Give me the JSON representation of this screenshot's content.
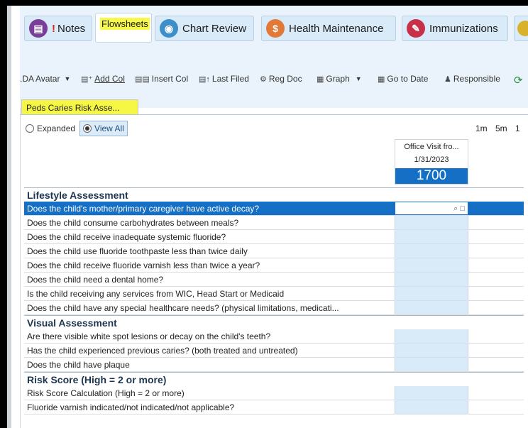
{
  "tabs": [
    {
      "label": "Notes",
      "icon": "notes-icon",
      "badge": "!"
    },
    {
      "label": "Flowsheets",
      "icon": "",
      "active": true
    },
    {
      "label": "Chart Review",
      "icon": "chart-review-icon"
    },
    {
      "label": "Health Maintenance",
      "icon": "health-maintenance-icon"
    },
    {
      "label": "Immunizations",
      "icon": "immunizations-icon"
    }
  ],
  "toolbar": {
    "avatar": ".DA Avatar",
    "add_col": "Add Col",
    "insert_col": "Insert Col",
    "last_filed": "Last Filed",
    "reg_doc": "Reg Doc",
    "graph": "Graph",
    "go_to_date": "Go to Date",
    "responsible": "Responsible"
  },
  "sheet_tab": "Peds Caries Risk Asse...",
  "view": {
    "expanded": "Expanded",
    "view_all": "View All",
    "times": "1m 5m 1"
  },
  "column": {
    "title": "Office Visit fro...",
    "date": "1/31/2023",
    "time": "1700"
  },
  "sections": [
    {
      "title": "Lifestyle Assessment",
      "rows": [
        "Does the child's mother/primary caregiver have active decay?",
        "Does the child consume carbohydrates between meals?",
        "Does the child receive inadequate systemic fluoride?",
        "Does the child use fluoride toothpaste less than twice daily",
        "Does the child receive fluoride varnish less than twice a year?",
        "Does the child need a dental home?",
        "Is the child receiving any services from WIC, Head Start or Medicaid",
        "Does the child have any special healthcare needs?  (physical limitations, medicati..."
      ]
    },
    {
      "title": "Visual Assessment",
      "rows": [
        "Are there visible white spot lesions or decay on the child's teeth?",
        "Has the child experienced previous caries? (both treated and untreated)",
        "Does the child have plaque"
      ]
    },
    {
      "title": "Risk Score (High = 2 or more)",
      "rows": [
        "Risk Score Calculation (High = 2 or more)",
        "Fluoride varnish indicated/not indicated/not applicable?"
      ]
    }
  ]
}
